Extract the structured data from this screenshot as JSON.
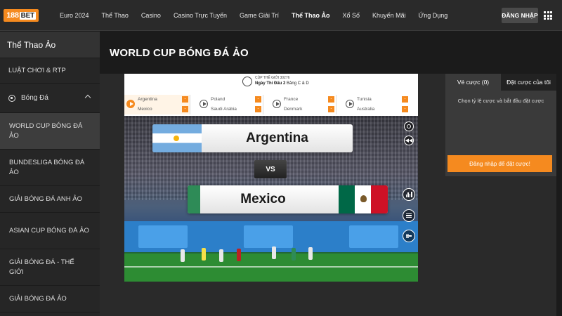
{
  "brand": {
    "logo_text": "188",
    "logo_suffix": "BET",
    "accent": "#f58a1f"
  },
  "topnav": {
    "items": [
      "Euro 2024",
      "Thể Thao",
      "Casino",
      "Casino Trực Tuyến",
      "Game Giải Trí",
      "Thể Thao Ảo",
      "Xổ Số",
      "Khuyến Mãi",
      "Ứng Dụng"
    ],
    "active_index": 5,
    "login_label": "ĐĂNG NHẬP"
  },
  "sidebar": {
    "title": "Thể Thao Ảo",
    "rules": "LUẬT CHƠI & RTP",
    "category": "Bóng Đá",
    "items": [
      {
        "label": "WORLD CUP BÓNG ĐÁ ẢO",
        "active": true
      },
      {
        "label": "BUNDESLIGA BÓNG ĐÁ ẢO",
        "active": false
      },
      {
        "label": "GIẢI BÓNG ĐÁ ANH ẢO",
        "active": false
      },
      {
        "label": "ASIAN CUP BÓNG ĐÁ ẢO",
        "active": false
      },
      {
        "label": "GIẢI BÓNG ĐÁ - THẾ GIỚI",
        "active": false
      },
      {
        "label": "GIẢI BÓNG ĐÁ ẢO",
        "active": false
      }
    ]
  },
  "main": {
    "title": "WORLD CUP BÓNG ĐÁ ẢO",
    "matchbar": {
      "cup_label": "CÚP THẾ GIỚI 30276",
      "day_label": "Ngày Thi Đấu 2",
      "group_label": "Bảng C & D",
      "matches": [
        {
          "home": "Argentina",
          "away": "Mexico",
          "active": true
        },
        {
          "home": "Poland",
          "away": "Saudi Arabia",
          "active": false
        },
        {
          "home": "France",
          "away": "Denmark",
          "active": false
        },
        {
          "home": "Tunisia",
          "away": "Australia",
          "active": false
        }
      ]
    },
    "video": {
      "home_team": "Argentina",
      "away_team": "Mexico",
      "vs_label": "VS"
    }
  },
  "betpanel": {
    "tabs": [
      "Vé cược (0)",
      "Đặt cược của tôi"
    ],
    "active_tab": 0,
    "message": "Chọn tỷ lệ cược và bắt đầu đặt cược",
    "login_cta": "Đăng nhập để đặt cược!"
  }
}
